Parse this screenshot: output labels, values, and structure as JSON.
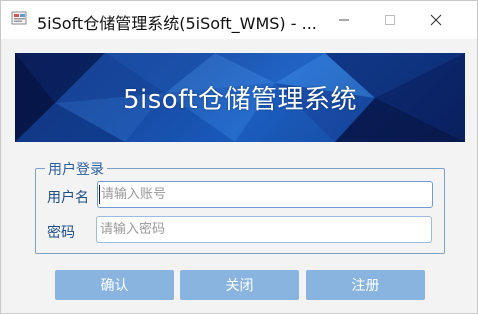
{
  "window": {
    "title": "5iSoft仓储管理系统(5iSoft_WMS) - ...",
    "app_icon": "app-icon",
    "controls": [
      "minimize-icon",
      "maximize-icon",
      "close-icon"
    ]
  },
  "banner": {
    "title": "5isoft仓储管理系统"
  },
  "login": {
    "group_title": "用户登录",
    "username_label": "用户名",
    "username_placeholder": "请输入账号",
    "username_value": "",
    "password_label": "密码",
    "password_placeholder": "请输入密码",
    "password_value": ""
  },
  "buttons": {
    "ok": "确认",
    "close": "关闭",
    "register": "注册"
  },
  "colors": {
    "button_bg": "#88b4df",
    "label_text": "#1c4d87",
    "group_border": "#7aa0c8",
    "banner_dark": "#0b1a4f",
    "banner_light": "#1b5fbf"
  }
}
